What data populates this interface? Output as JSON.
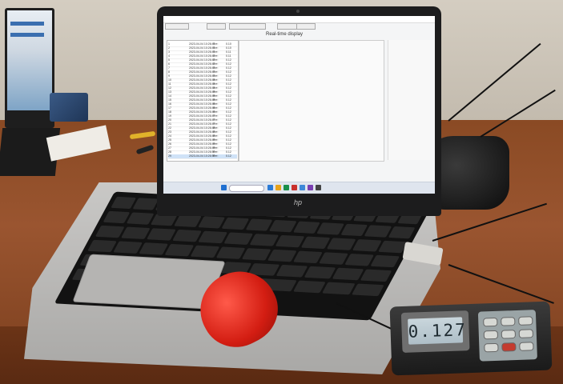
{
  "scene": {
    "description_labels": {
      "laptop_brand": "hp"
    }
  },
  "app": {
    "chart_title": "Real-time display",
    "toolbar": [
      "",
      "",
      "",
      "",
      ""
    ],
    "table_rows": [
      {
        "c1": "1",
        "c2": "2023-04-04 10:26:41",
        "c3": "Pre:",
        "c4": "0.10"
      },
      {
        "c1": "2",
        "c2": "2023-04-04 10:26:41",
        "c3": "Pre:",
        "c4": "0.10"
      },
      {
        "c1": "3",
        "c2": "2023-04-04 10:26:41",
        "c3": "Pre:",
        "c4": "0.11"
      },
      {
        "c1": "4",
        "c2": "2023-04-04 10:26:42",
        "c3": "Pre:",
        "c4": "0.11"
      },
      {
        "c1": "5",
        "c2": "2023-04-04 10:26:42",
        "c3": "Pre:",
        "c4": "0.12"
      },
      {
        "c1": "6",
        "c2": "2023-04-04 10:26:42",
        "c3": "Pre:",
        "c4": "0.12"
      },
      {
        "c1": "7",
        "c2": "2023-04-04 10:26:43",
        "c3": "Pre:",
        "c4": "0.12"
      },
      {
        "c1": "8",
        "c2": "2023-04-04 10:26:43",
        "c3": "Pre:",
        "c4": "0.12"
      },
      {
        "c1": "9",
        "c2": "2023-04-04 10:26:43",
        "c3": "Pre:",
        "c4": "0.12"
      },
      {
        "c1": "10",
        "c2": "2023-04-04 10:26:44",
        "c3": "Pre:",
        "c4": "0.12"
      },
      {
        "c1": "11",
        "c2": "2023-04-04 10:26:44",
        "c3": "Pre:",
        "c4": "0.12"
      },
      {
        "c1": "12",
        "c2": "2023-04-04 10:26:44",
        "c3": "Pre:",
        "c4": "0.12"
      },
      {
        "c1": "13",
        "c2": "2023-04-04 10:26:45",
        "c3": "Pre:",
        "c4": "0.12"
      },
      {
        "c1": "14",
        "c2": "2023-04-04 10:26:45",
        "c3": "Pre:",
        "c4": "0.12"
      },
      {
        "c1": "15",
        "c2": "2023-04-04 10:26:45",
        "c3": "Pre:",
        "c4": "0.12"
      },
      {
        "c1": "16",
        "c2": "2023-04-04 10:26:46",
        "c3": "Pre:",
        "c4": "0.12"
      },
      {
        "c1": "17",
        "c2": "2023-04-04 10:26:46",
        "c3": "Pre:",
        "c4": "0.12"
      },
      {
        "c1": "18",
        "c2": "2023-04-04 10:26:46",
        "c3": "Pre:",
        "c4": "0.12"
      },
      {
        "c1": "19",
        "c2": "2023-04-04 10:26:47",
        "c3": "Pre:",
        "c4": "0.12"
      },
      {
        "c1": "20",
        "c2": "2023-04-04 10:26:47",
        "c3": "Pre:",
        "c4": "0.12"
      },
      {
        "c1": "21",
        "c2": "2023-04-04 10:26:47",
        "c3": "Pre:",
        "c4": "0.12"
      },
      {
        "c1": "22",
        "c2": "2023-04-04 10:26:48",
        "c3": "Pre:",
        "c4": "0.12"
      },
      {
        "c1": "23",
        "c2": "2023-04-04 10:26:48",
        "c3": "Pre:",
        "c4": "0.12"
      },
      {
        "c1": "24",
        "c2": "2023-04-04 10:26:48",
        "c3": "Pre:",
        "c4": "0.12"
      },
      {
        "c1": "25",
        "c2": "2023-04-04 10:26:49",
        "c3": "Pre:",
        "c4": "0.12"
      },
      {
        "c1": "26",
        "c2": "2023-04-04 10:26:49",
        "c3": "Pre:",
        "c4": "0.12"
      },
      {
        "c1": "27",
        "c2": "2023-04-04 10:26:49",
        "c3": "Pre:",
        "c4": "0.12"
      },
      {
        "c1": "28",
        "c2": "2023-04-04 10:26:50",
        "c3": "Pre:",
        "c4": "0.12"
      },
      {
        "c1": "29",
        "c2": "2023-04-04 10:26:50",
        "c3": "Pre:",
        "c4": "0.12"
      }
    ],
    "taskbar": {
      "search_placeholder": "Search"
    }
  },
  "meter": {
    "lcd_value": "0.127"
  },
  "colors": {
    "mouse": "#d31d12",
    "desk": "#8a4a24",
    "taskbar": "#dfe5ee"
  }
}
